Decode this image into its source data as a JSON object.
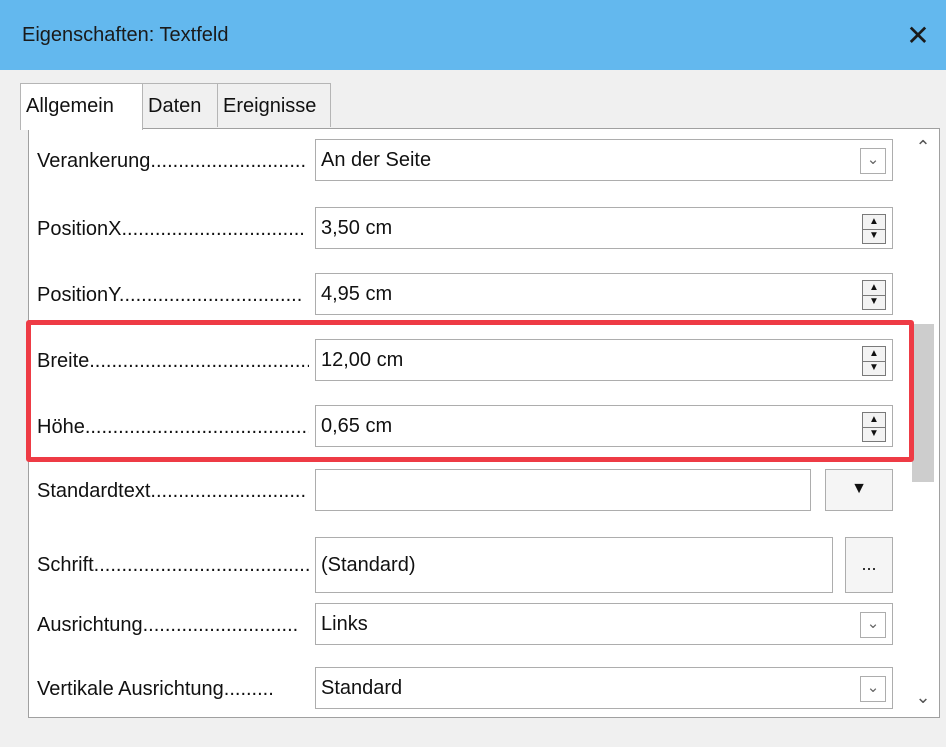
{
  "window": {
    "title": "Eigenschaften: Textfeld",
    "close_label": "✕"
  },
  "tabs": [
    {
      "label": "Allgemein",
      "active": true
    },
    {
      "label": "Daten",
      "active": false
    },
    {
      "label": "Ereignisse",
      "active": false
    }
  ],
  "rows": {
    "verankerung": {
      "label": "Verankerung............................",
      "value": "An der Seite"
    },
    "positionx": {
      "label": "PositionX.................................",
      "value": "3,50 cm"
    },
    "positiony": {
      "label": "PositionY.................................",
      "value": "4,95 cm"
    },
    "breite": {
      "label": "Breite...........................................",
      "value": "12,00 cm"
    },
    "hoehe": {
      "label": "Höhe.............................................",
      "value": "0,65 cm"
    },
    "standardtext": {
      "label": "Standardtext............................",
      "value": ""
    },
    "schrift": {
      "label": "Schrift...........................................",
      "value": "(Standard)",
      "button": "..."
    },
    "ausrichtung": {
      "label": "Ausrichtung............................",
      "value": "Links"
    },
    "vertikale": {
      "label": "Vertikale Ausrichtung.........",
      "value": "Standard"
    }
  },
  "icons": {
    "dropdown": "chevron-down-icon",
    "spin": "spin-arrows-icon",
    "scroll_up": "caret-up-icon",
    "scroll_down": "caret-down-icon"
  },
  "colors": {
    "titlebar": "#63b8ee",
    "highlight": "#ee3b45"
  }
}
